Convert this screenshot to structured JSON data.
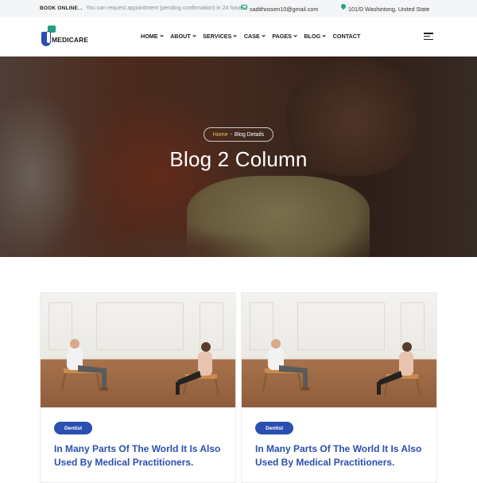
{
  "topbar": {
    "book_label": "BOOK ONLINE",
    "appointment_text": "You can request appointment (pending confirmation) in 24 hours",
    "email": "sadithossen10@gmail.com",
    "address": "101/D Washintong, United State"
  },
  "header": {
    "brand": "MEDICARE",
    "nav": [
      "HOME",
      "ABOUT",
      "SERVICES",
      "CASE",
      "PAGES",
      "BLOG",
      "CONTACT"
    ],
    "nav_has_dropdown": [
      true,
      true,
      true,
      true,
      true,
      true,
      false
    ]
  },
  "hero": {
    "breadcrumb_home": "Home",
    "breadcrumb_separator": "-",
    "breadcrumb_current": "Blog Details",
    "title": "Blog 2 Column"
  },
  "posts": [
    {
      "category": "Dentist",
      "title": "In Many Parts Of The World It Is Also Used By Medical Practitioners."
    },
    {
      "category": "Dentist",
      "title": "In Many Parts Of The World It Is Also Used By Medical Practitioners."
    }
  ],
  "colors": {
    "accent_green": "#22a27a",
    "brand_blue": "#2a4fb0",
    "breadcrumb_home": "#f7c948"
  },
  "icons": {
    "appointment": "arrow-right-icon",
    "email": "mail-icon",
    "address": "location-pin-icon",
    "menu": "hamburger-menu-icon"
  }
}
